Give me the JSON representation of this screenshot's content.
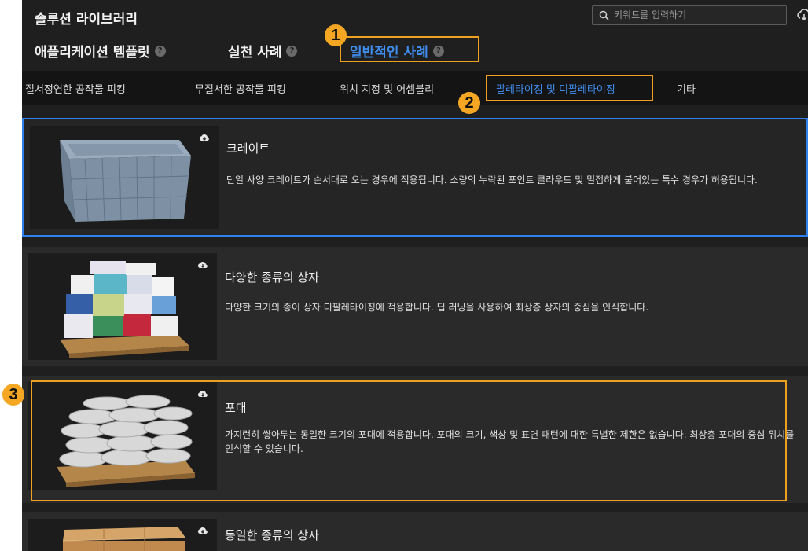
{
  "header": {
    "title": "솔루션 라이브러리",
    "search_placeholder": "키워드를 입력하기"
  },
  "main_tabs": [
    {
      "label": "애플리케이션 템플릿",
      "help": "?"
    },
    {
      "label": "실천 사례",
      "help": "?"
    },
    {
      "label": "일반적인 사례",
      "help": "?",
      "active": true
    }
  ],
  "categories": [
    {
      "label": "질서정연한 공작물 피킹"
    },
    {
      "label": "무질서한 공작물 피킹"
    },
    {
      "label": "위치 지정 및 어셈블리"
    },
    {
      "label": "팔레타이징 및 디팔레타이징",
      "active": true
    },
    {
      "label": "기타"
    }
  ],
  "cards": [
    {
      "title": "크레이트",
      "description": "단일 사양 크레이트가 순서대로 오는 경우에 적용됩니다. 소량의 누락된 포인트 클라우드 및 밀접하게 붙어있는 특수 경우가 허용됩니다.",
      "image": "crate-image"
    },
    {
      "title": "다양한 종류의 상자",
      "description": "다양한 크기의 종이 상자 디팔레타이징에 적용합니다. 딥 러닝을 사용하여 최상층 상자의 중심을 인식합니다.",
      "image": "mixed-boxes-image"
    },
    {
      "title": "포대",
      "description": "가지런히 쌓아두는 동일한 크기의 포대에 적용합니다. 포대의 크기, 색상 및 표면 패턴에 대한 특별한 제한은 없습니다. 최상층 포대의 중심 위치를 인식할 수 있습니다.",
      "image": "sacks-image"
    },
    {
      "title": "동일한 종류의 상자",
      "description": "",
      "image": "uniform-boxes-image"
    }
  ],
  "annotations": {
    "step1": "1",
    "step2": "2",
    "step3": "3"
  },
  "colors": {
    "accent": "#3f8ef0",
    "highlight": "#f0a020",
    "badge": "#f5a623",
    "selected_border": "#2f80ed"
  }
}
